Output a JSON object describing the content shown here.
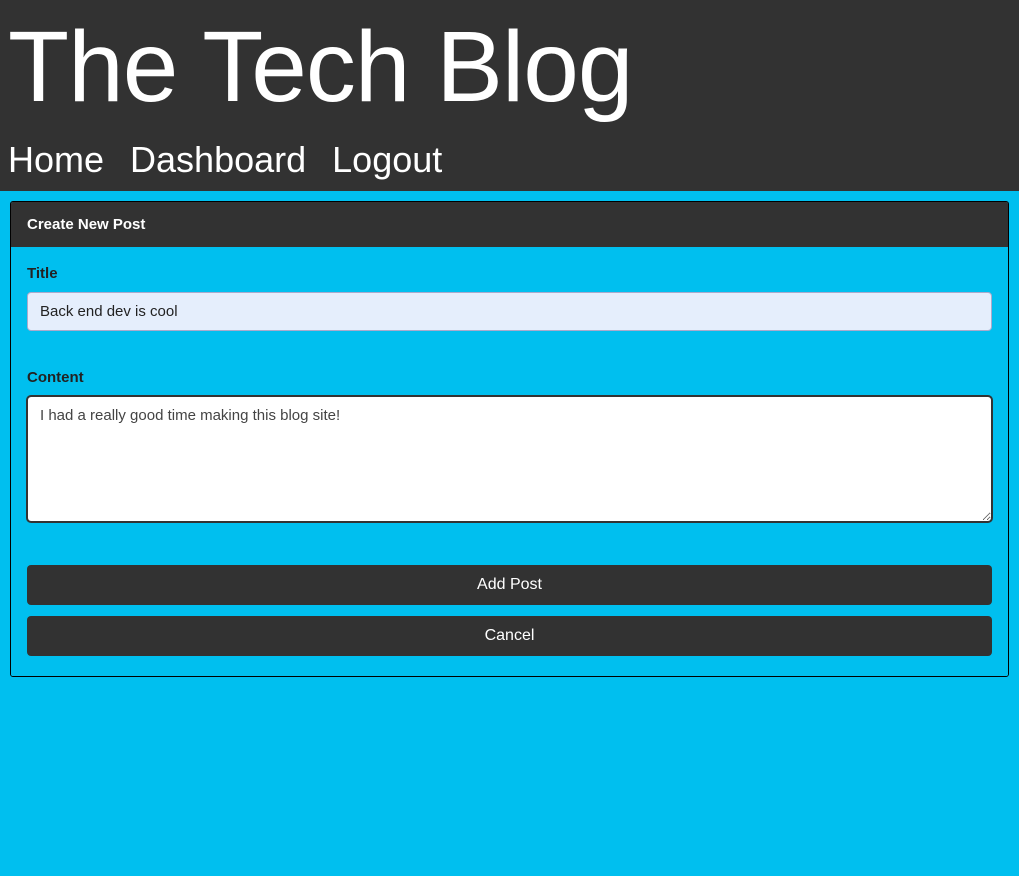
{
  "header": {
    "site_title": "The Tech Blog",
    "nav": {
      "home": "Home",
      "dashboard": "Dashboard",
      "logout": "Logout"
    }
  },
  "panel": {
    "title": "Create New Post",
    "form": {
      "title_label": "Title",
      "title_value": "Back end dev is cool",
      "content_label": "Content",
      "content_value": "I had a really good time making this blog site!"
    },
    "buttons": {
      "add_post": "Add Post",
      "cancel": "Cancel"
    }
  }
}
